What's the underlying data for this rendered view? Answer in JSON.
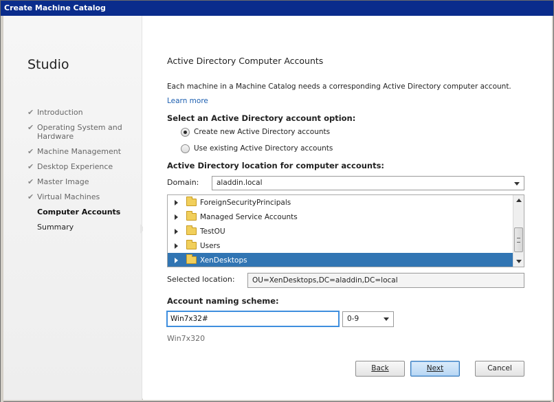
{
  "window": {
    "title": "Create Machine Catalog"
  },
  "sidebar": {
    "brand": "Studio",
    "steps": [
      {
        "label": "Introduction",
        "done": true
      },
      {
        "label": "Operating System and Hardware",
        "done": true
      },
      {
        "label": "Machine Management",
        "done": true
      },
      {
        "label": "Desktop Experience",
        "done": true
      },
      {
        "label": "Master Image",
        "done": true
      },
      {
        "label": "Virtual Machines",
        "done": true
      },
      {
        "label": "Computer Accounts",
        "current": true
      },
      {
        "label": "Summary"
      }
    ]
  },
  "main": {
    "heading": "Active Directory Computer Accounts",
    "description": "Each machine in a Machine Catalog needs a corresponding Active Directory computer account.",
    "learn_more": "Learn more",
    "account_option_label": "Select an Active Directory account option:",
    "options": [
      {
        "label": "Create new Active Directory accounts",
        "selected": true
      },
      {
        "label": "Use existing Active Directory accounts",
        "selected": false
      }
    ],
    "location_label": "Active Directory location for computer accounts:",
    "domain_label": "Domain:",
    "domain_value": "aladdin.local",
    "tree_items": [
      "ForeignSecurityPrincipals",
      "Managed Service Accounts",
      "TestOU",
      "Users",
      "XenDesktops"
    ],
    "tree_selected": "XenDesktops",
    "selected_location_label": "Selected location:",
    "selected_location_value": "OU=XenDesktops,DC=aladdin,DC=local",
    "naming_label": "Account naming scheme:",
    "naming_value": "Win7x32#",
    "naming_type": "0-9",
    "naming_preview": "Win7x320"
  },
  "buttons": {
    "back": "Back",
    "next": "Next",
    "cancel": "Cancel"
  },
  "colors": {
    "titlebar": "#0a2c8c",
    "selection": "#3175b3",
    "link": "#1d5fb0"
  }
}
